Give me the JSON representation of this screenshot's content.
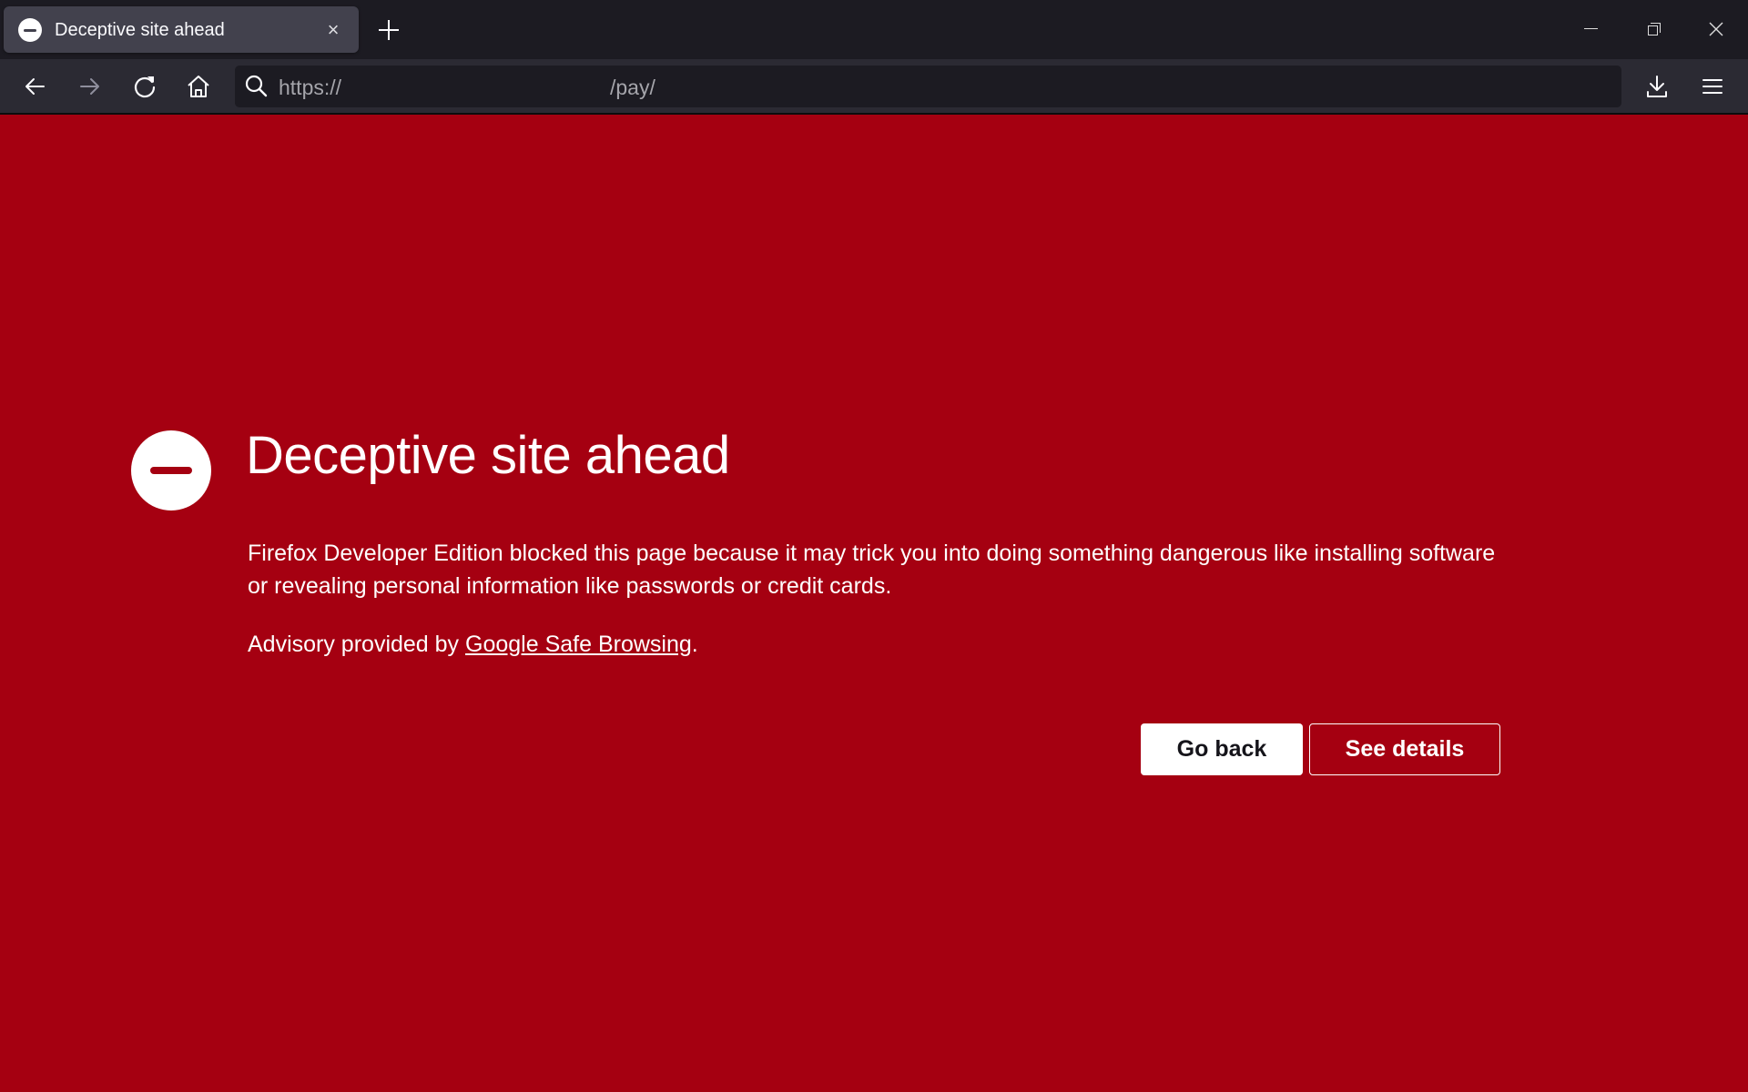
{
  "tabbar": {
    "tabs": [
      {
        "title": "Deceptive site ahead",
        "icon": "blocked-icon",
        "close_glyph": "×"
      }
    ],
    "new_tab_icon": "plus-icon",
    "window_controls": {
      "minimize": "minimize-icon",
      "maximize": "restore-icon",
      "close": "close-icon"
    }
  },
  "toolbar": {
    "buttons": [
      "back-icon",
      "forward-icon",
      "reload-icon",
      "home-icon",
      "download-icon",
      "menu-icon"
    ],
    "url": {
      "scheme": "https://",
      "path": "/pay/"
    }
  },
  "page": {
    "title": "Deceptive site ahead",
    "description": "Firefox Developer Edition blocked this page because it may trick you into doing something dangerous like installing software or revealing personal information like passwords or credit cards.",
    "advisory_prefix": "Advisory provided by ",
    "advisory_link": "Google Safe Browsing",
    "advisory_suffix": ".",
    "buttons": {
      "go_back": "Go back",
      "see_details": "See details"
    },
    "colors": {
      "background": "#a50011",
      "text": "#ffffff"
    }
  }
}
